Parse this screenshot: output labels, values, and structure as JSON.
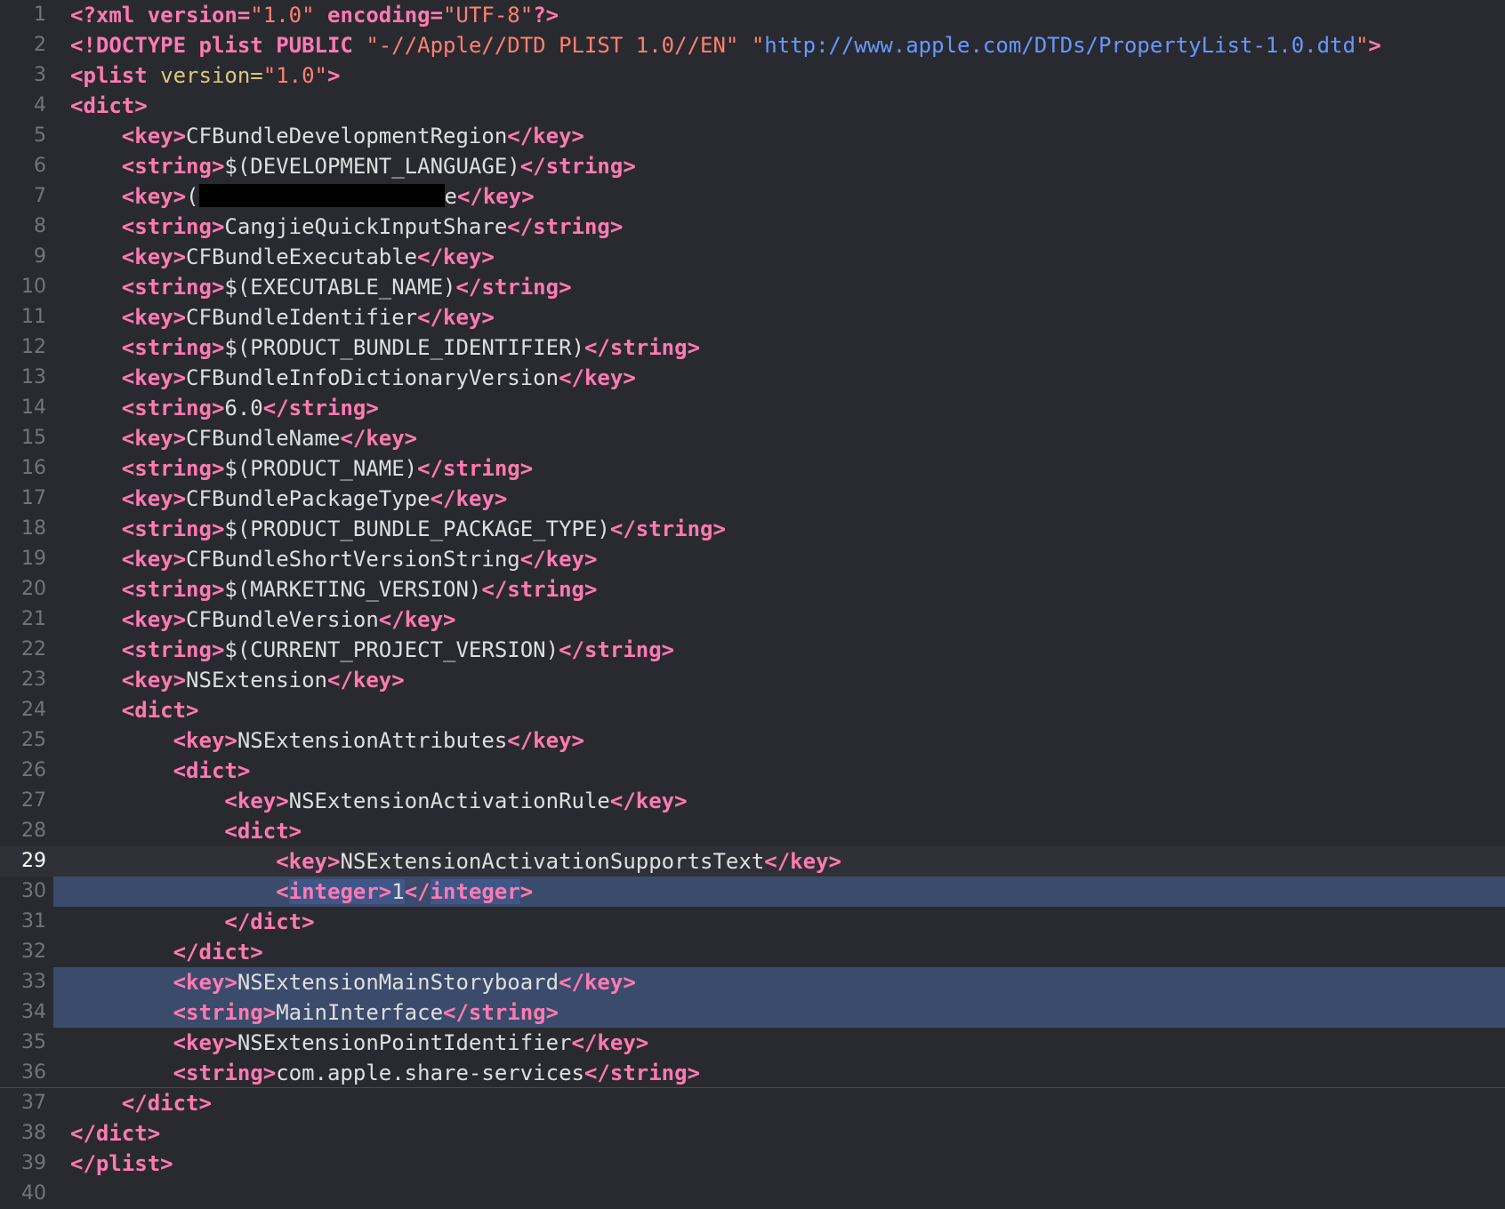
{
  "editor": {
    "colors": {
      "background": "#292a30",
      "tag": "#ff7ab2",
      "text": "#dfdfe0",
      "string": "#ff8170",
      "url": "#6699ff",
      "attribute": "#d9c97c",
      "selection": "#3b4b6b"
    },
    "current_line": 29,
    "selected_lines": [
      30,
      33,
      34
    ],
    "line_numbers": [
      "1",
      "2",
      "3",
      "4",
      "5",
      "6",
      "7",
      "8",
      "9",
      "10",
      "11",
      "12",
      "13",
      "14",
      "15",
      "16",
      "17",
      "18",
      "19",
      "20",
      "21",
      "22",
      "23",
      "24",
      "25",
      "26",
      "27",
      "28",
      "29",
      "30",
      "31",
      "32",
      "33",
      "34",
      "35",
      "36",
      "37",
      "38",
      "39",
      "40"
    ],
    "l1": {
      "decl_open": "<?xml version=",
      "version_val": "\"1.0\"",
      "enc_attr": " encoding=",
      "enc_val": "\"UTF-8\"",
      "decl_close": "?>"
    },
    "l2": {
      "doctype_open": "<!DOCTYPE plist PUBLIC ",
      "public_id": "\"-//Apple//DTD PLIST 1.0//EN\"",
      "space": " ",
      "q1": "\"",
      "dtd_url": "http://www.apple.com/DTDs/PropertyList-1.0.dtd",
      "q2": "\"",
      "close": ">"
    },
    "l3": {
      "open": "<plist ",
      "attr": "version=",
      "val": "\"1.0\"",
      "close": ">"
    },
    "l4": {
      "tag": "<dict>"
    },
    "l5": {
      "open": "<key>",
      "text": "CFBundleDevelopmentRegion",
      "close": "</key>"
    },
    "l6": {
      "open": "<string>",
      "text": "$(DEVELOPMENT_LANGUAGE)",
      "close": "</string>"
    },
    "l7": {
      "open": "<key>",
      "lead": "(",
      "tail": "e",
      "close": "</key>"
    },
    "l8": {
      "open": "<string>",
      "text": "CangjieQuickInputShare",
      "close": "</string>"
    },
    "l9": {
      "open": "<key>",
      "text": "CFBundleExecutable",
      "close": "</key>"
    },
    "l10": {
      "open": "<string>",
      "text": "$(EXECUTABLE_NAME)",
      "close": "</string>"
    },
    "l11": {
      "open": "<key>",
      "text": "CFBundleIdentifier",
      "close": "</key>"
    },
    "l12": {
      "open": "<string>",
      "text": "$(PRODUCT_BUNDLE_IDENTIFIER)",
      "close": "</string>"
    },
    "l13": {
      "open": "<key>",
      "text": "CFBundleInfoDictionaryVersion",
      "close": "</key>"
    },
    "l14": {
      "open": "<string>",
      "text": "6.0",
      "close": "</string>"
    },
    "l15": {
      "open": "<key>",
      "text": "CFBundleName",
      "close": "</key>"
    },
    "l16": {
      "open": "<string>",
      "text": "$(PRODUCT_NAME)",
      "close": "</string>"
    },
    "l17": {
      "open": "<key>",
      "text": "CFBundlePackageType",
      "close": "</key>"
    },
    "l18": {
      "open": "<string>",
      "text": "$(PRODUCT_BUNDLE_PACKAGE_TYPE)",
      "close": "</string>"
    },
    "l19": {
      "open": "<key>",
      "text": "CFBundleShortVersionString",
      "close": "</key>"
    },
    "l20": {
      "open": "<string>",
      "text": "$(MARKETING_VERSION)",
      "close": "</string>"
    },
    "l21": {
      "open": "<key>",
      "text": "CFBundleVersion",
      "close": "</key>"
    },
    "l22": {
      "open": "<string>",
      "text": "$(CURRENT_PROJECT_VERSION)",
      "close": "</string>"
    },
    "l23": {
      "open": "<key>",
      "text": "NSExtension",
      "close": "</key>"
    },
    "l24": {
      "tag": "<dict>"
    },
    "l25": {
      "open": "<key>",
      "text": "NSExtensionAttributes",
      "close": "</key>"
    },
    "l26": {
      "tag": "<dict>"
    },
    "l27": {
      "open": "<key>",
      "text": "NSExtensionActivationRule",
      "close": "</key>"
    },
    "l28": {
      "tag": "<dict>"
    },
    "l29": {
      "open": "<key>",
      "text": "NSExtensionActivationSupportsText",
      "close": "</key>"
    },
    "l30": {
      "lt1": "<",
      "name1": "integer",
      "gt1": ">",
      "value": "1",
      "lt2": "</",
      "name2": "integer",
      "gt2": ">"
    },
    "l31": {
      "tag": "</dict>"
    },
    "l32": {
      "tag": "</dict>"
    },
    "l33": {
      "open": "<key>",
      "text": "NSExtensionMainStoryboard",
      "close": "</key>"
    },
    "l34": {
      "open": "<string>",
      "text": "MainInterface",
      "close": "</string>"
    },
    "l35": {
      "open": "<key>",
      "text": "NSExtensionPointIdentifier",
      "close": "</key>"
    },
    "l36": {
      "open": "<string>",
      "text": "com.apple.share-services",
      "close": "</string>"
    },
    "l37": {
      "tag": "</dict>"
    },
    "l38": {
      "tag": "</dict>"
    },
    "l39": {
      "tag": "</plist>"
    }
  }
}
